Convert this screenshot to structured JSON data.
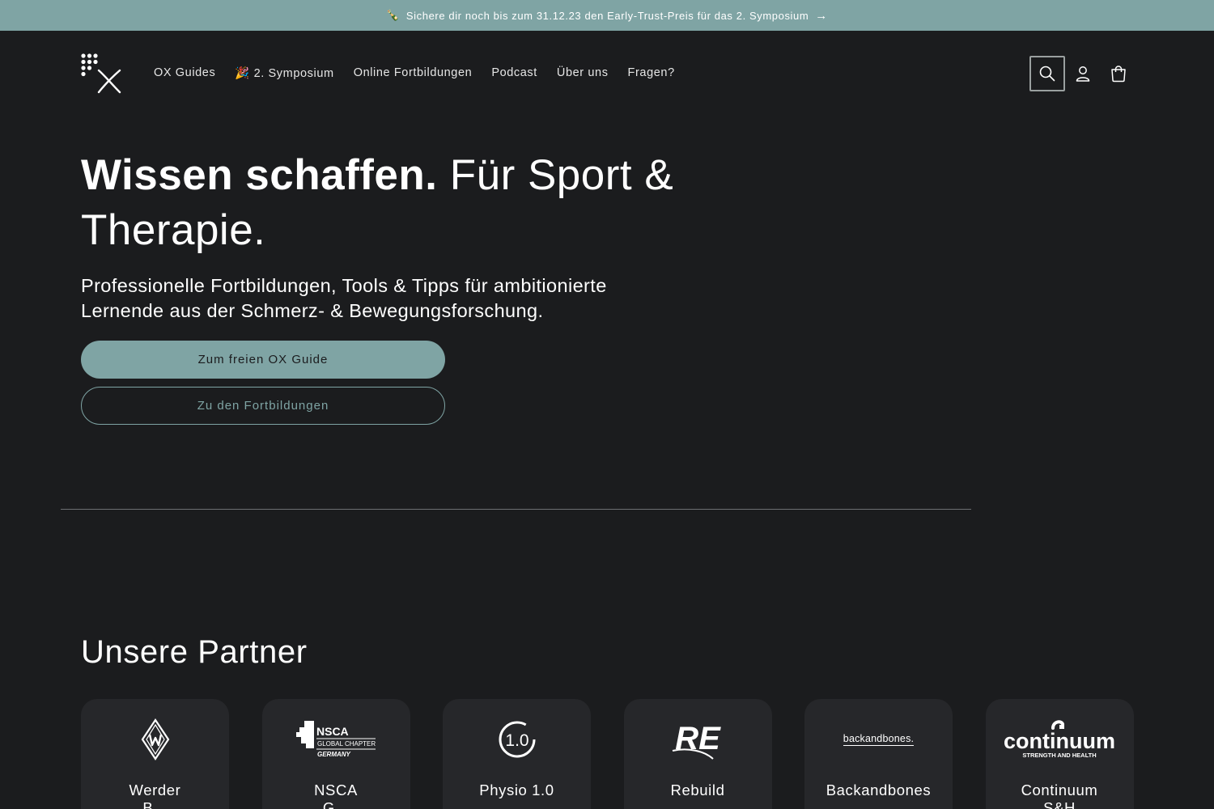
{
  "announcement": {
    "emoji": "🍾",
    "text": "Sichere dir noch bis zum 31.12.23 den Early-Trust-Preis für das 2. Symposium",
    "arrow": "→"
  },
  "nav": {
    "items": [
      {
        "label": "OX Guides"
      },
      {
        "label": "🎉 2. Symposium"
      },
      {
        "label": "Online Fortbildungen"
      },
      {
        "label": "Podcast"
      },
      {
        "label": "Über uns"
      },
      {
        "label": "Fragen?"
      }
    ]
  },
  "header_icons": [
    "search-icon",
    "account-icon",
    "cart-icon"
  ],
  "hero": {
    "title_bold": "Wissen schaffen.",
    "title_rest": " Für Sport & Therapie.",
    "subtitle": "Professionelle Fortbildungen, Tools & Tipps für ambitionierte Lernende aus der Schmerz- & Bewegungsforschung.",
    "primary_button": "Zum freien OX Guide",
    "secondary_button": "Zu den Fortbildungen"
  },
  "partners": {
    "title": "Unsere Partner",
    "items": [
      {
        "name_line1": "Werder",
        "name_line2": "B...",
        "logo": "werder-logo"
      },
      {
        "name_line1": "NSCA",
        "name_line2": "G...",
        "logo": "nsca-logo",
        "logo_text": [
          "NSCA",
          "GLOBAL CHAPTER",
          "GERMANY"
        ]
      },
      {
        "name_line1": "Physio 1.0",
        "name_line2": "",
        "logo": "physio-logo",
        "logo_text": "1.0"
      },
      {
        "name_line1": "Rebuild",
        "name_line2": "",
        "logo": "rebuild-logo",
        "logo_text": "RE"
      },
      {
        "name_line1": "Backandbones",
        "name_line2": "",
        "logo": "backandbones-logo",
        "logo_text": "backandbones."
      },
      {
        "name_line1": "Continuum",
        "name_line2": "S&H",
        "logo": "continuum-logo",
        "logo_text": [
          "continuum",
          "STRENGTH AND HEALTH"
        ]
      }
    ]
  },
  "colors": {
    "background": "#1b1c1e",
    "accent": "#7fa4a4",
    "card": "#26272a"
  }
}
